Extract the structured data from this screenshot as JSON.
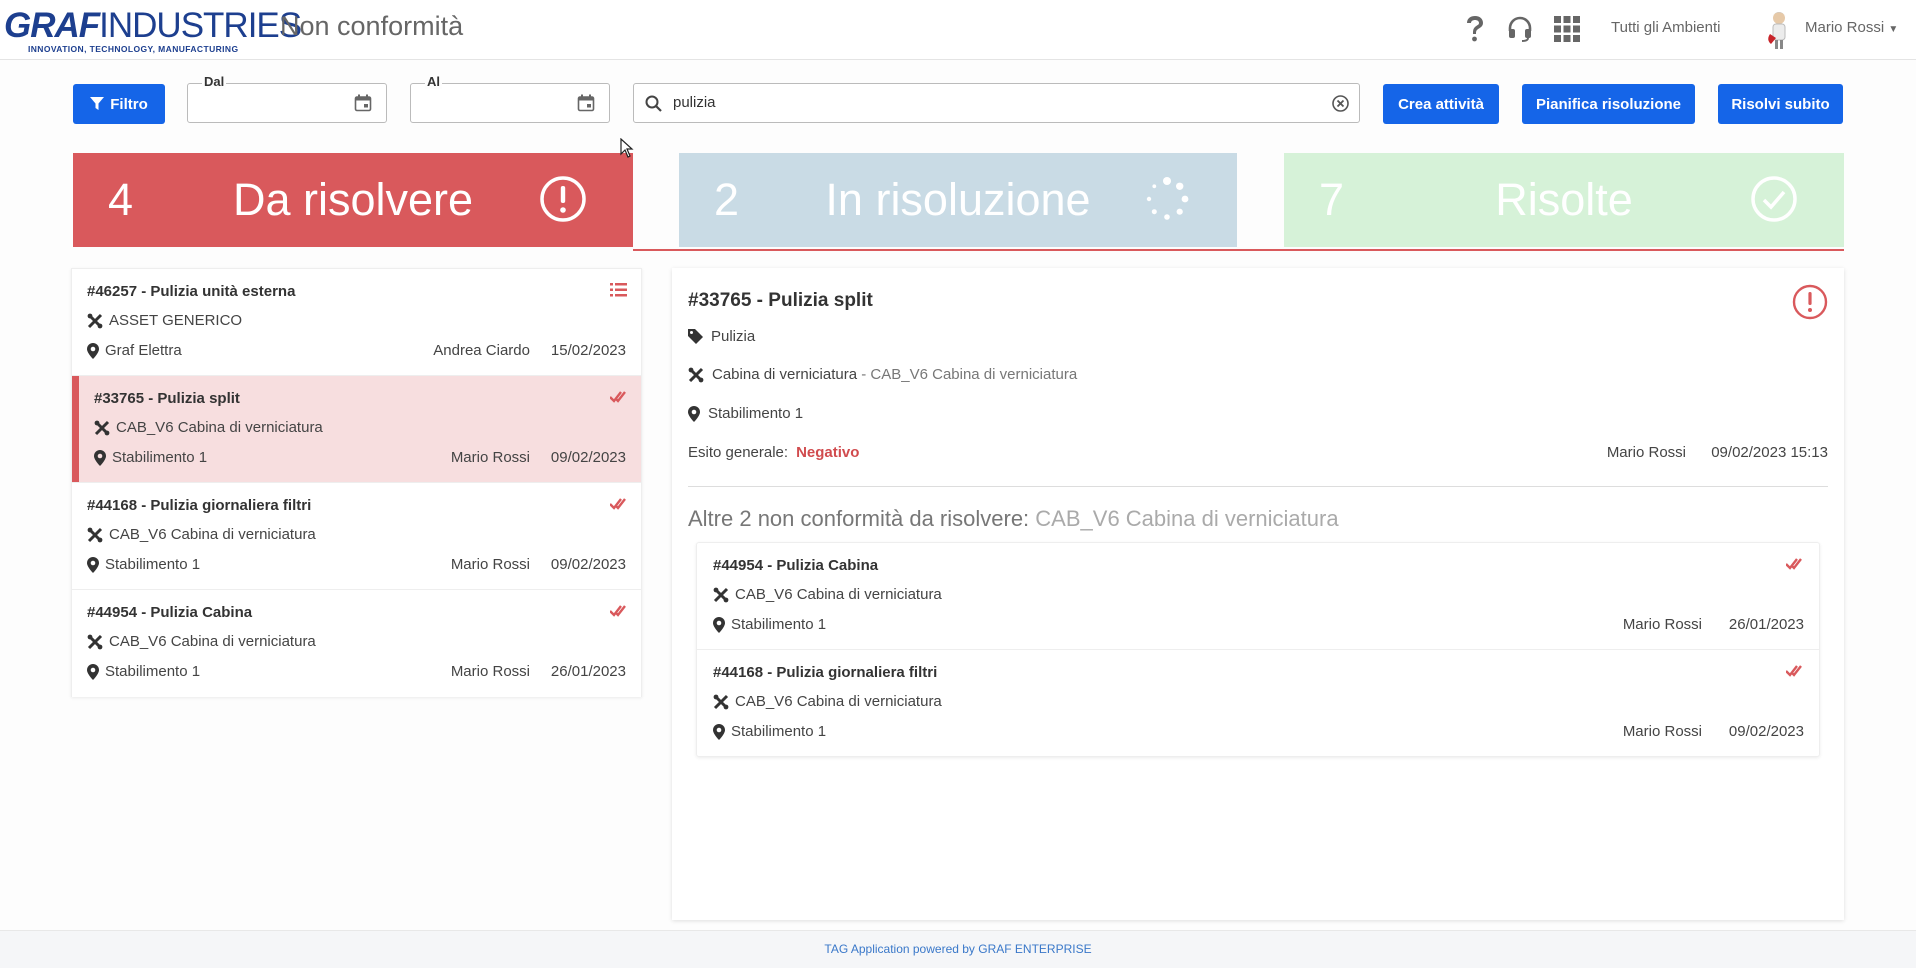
{
  "header": {
    "logo_main_bold": "GRAF",
    "logo_main_rest": "INDUSTRIES",
    "logo_sub": "INNOVATION, TECHNOLOGY, MANUFACTURING",
    "title": "Non conformità",
    "icons": [
      "help-icon",
      "support-headset-icon",
      "apps-grid-icon"
    ],
    "environment": "Tutti gli Ambienti",
    "user": "Mario Rossi"
  },
  "toolbar": {
    "filter_label": "Filtro",
    "date_from_label": "Dal",
    "date_from_value": "",
    "date_to_label": "Al",
    "date_to_value": "",
    "search_value": "pulizia",
    "search_placeholder": "",
    "btn_create": "Crea attività",
    "btn_plan": "Pianifica risoluzione",
    "btn_resolve": "Risolvi subito"
  },
  "status_tabs": [
    {
      "count": "4",
      "label": "Da risolvere",
      "icon": "alert-circle-icon",
      "color": "#d9595c",
      "active": true
    },
    {
      "count": "2",
      "label": "In risoluzione",
      "icon": "spinner-icon",
      "color": "#c9dbe5",
      "active": false
    },
    {
      "count": "7",
      "label": "Risolte",
      "icon": "check-circle-icon",
      "color": "#d6f2d8",
      "active": false
    }
  ],
  "list": [
    {
      "title": "#46257 - Pulizia unità esterna",
      "asset": "ASSET GENERICO",
      "location": "Graf Elettra",
      "user": "Andrea Ciardo",
      "date": "15/02/2023",
      "status_icon": "list-icon",
      "selected": false
    },
    {
      "title": "#33765 - Pulizia split",
      "asset": "CAB_V6 Cabina di verniciatura",
      "location": "Stabilimento 1",
      "user": "Mario Rossi",
      "date": "09/02/2023",
      "status_icon": "double-check-icon",
      "selected": true
    },
    {
      "title": "#44168 - Pulizia giornaliera filtri",
      "asset": "CAB_V6 Cabina di verniciatura",
      "location": "Stabilimento 1",
      "user": "Mario Rossi",
      "date": "09/02/2023",
      "status_icon": "double-check-icon",
      "selected": false
    },
    {
      "title": "#44954 - Pulizia Cabina",
      "asset": "CAB_V6 Cabina di verniciatura",
      "location": "Stabilimento 1",
      "user": "Mario Rossi",
      "date": "26/01/2023",
      "status_icon": "double-check-icon",
      "selected": false
    }
  ],
  "detail": {
    "title": "#33765 - Pulizia split",
    "tag": "Pulizia",
    "asset_name": "Cabina di verniciatura",
    "asset_code": " - CAB_V6 Cabina di verniciatura",
    "location": "Stabilimento 1",
    "outcome_label": "Esito generale:",
    "outcome_value": "Negativo",
    "user": "Mario Rossi",
    "datetime": "09/02/2023 15:13",
    "related_heading": "Altre 2 non conformità da risolvere:",
    "related_asset": "CAB_V6 Cabina di verniciatura",
    "related": [
      {
        "title": "#44954 - Pulizia Cabina",
        "asset": "CAB_V6 Cabina di verniciatura",
        "location": "Stabilimento 1",
        "user": "Mario Rossi",
        "date": "26/01/2023"
      },
      {
        "title": "#44168 - Pulizia giornaliera filtri",
        "asset": "CAB_V6 Cabina di verniciatura",
        "location": "Stabilimento 1",
        "user": "Mario Rossi",
        "date": "09/02/2023"
      }
    ]
  },
  "footer": "TAG Application powered by GRAF ENTERPRISE",
  "colors": {
    "accent": "#1565e8",
    "danger": "#d9595c",
    "text": "#333333"
  }
}
